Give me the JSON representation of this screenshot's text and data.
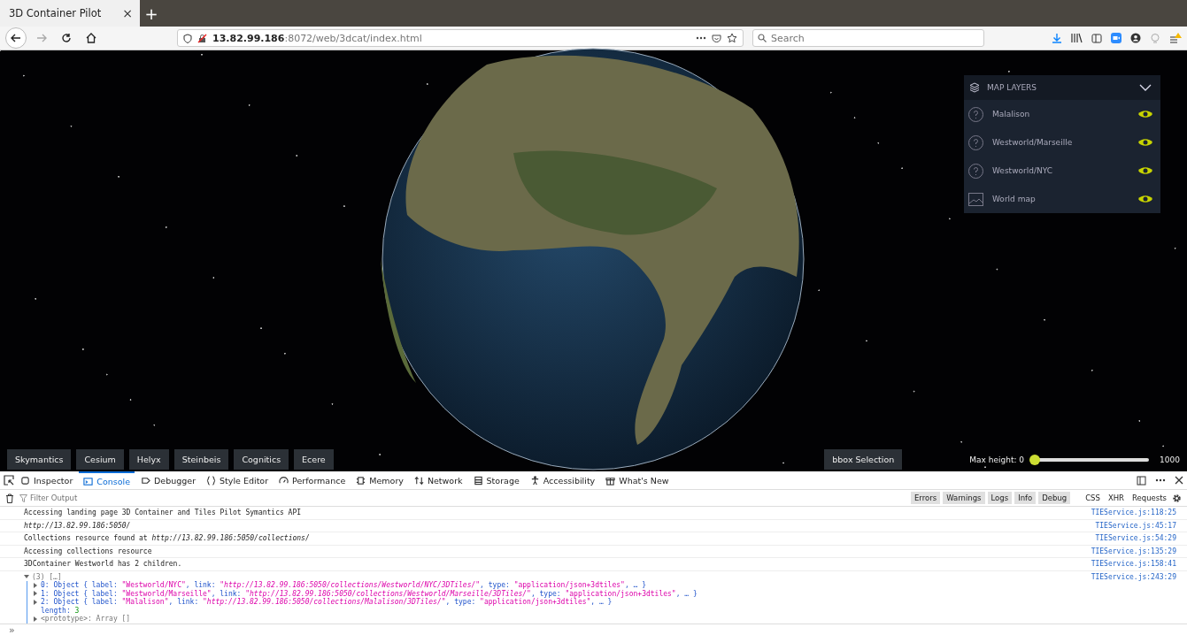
{
  "browser": {
    "tabs": [
      {
        "title": "3D Container Pilot",
        "close": "×",
        "selected": true
      }
    ],
    "new_tab": "+",
    "url": {
      "host": "13.82.99.186",
      "path": ":8072/web/3dcat/index.html"
    },
    "search": {
      "placeholder": "Search"
    }
  },
  "map_layers": {
    "title": "MAP LAYERS",
    "expanded": true,
    "layers": [
      {
        "name": "Malalison",
        "kind": "unknown",
        "visible": true
      },
      {
        "name": "Westworld/Marseille",
        "kind": "unknown",
        "visible": true
      },
      {
        "name": "Westworld/NYC",
        "kind": "unknown",
        "visible": true
      },
      {
        "name": "World map",
        "kind": "image",
        "visible": true
      }
    ]
  },
  "providers": [
    "Skymantics",
    "Cesium",
    "Helyx",
    "Steinbeis",
    "Cognitics",
    "Ecere"
  ],
  "bbox_button": "bbox Selection",
  "max_height": {
    "label": "Max height: 0",
    "level": 0,
    "max": "1000"
  },
  "devtools": {
    "tabs": [
      {
        "label": "Inspector",
        "selected": false
      },
      {
        "label": "Console",
        "selected": true
      },
      {
        "label": "Debugger",
        "selected": false
      },
      {
        "label": "Style Editor",
        "selected": false
      },
      {
        "label": "Performance",
        "selected": false
      },
      {
        "label": "Memory",
        "selected": false
      },
      {
        "label": "Network",
        "selected": false
      },
      {
        "label": "Storage",
        "selected": false
      },
      {
        "label": "Accessibility",
        "selected": false
      },
      {
        "label": "What's New",
        "selected": false
      }
    ],
    "filter_placeholder": "Filter Output",
    "levels": [
      "Errors",
      "Warnings",
      "Logs",
      "Info",
      "Debug"
    ],
    "extra_filters": [
      "CSS",
      "XHR",
      "Requests"
    ],
    "messages": [
      {
        "kind": "text",
        "text": "Accessing landing page 3D Container and Tiles Pilot Symantics API",
        "source": "TIEService.js:118:25"
      },
      {
        "kind": "italic",
        "text": "http://13.82.99.186:5050/",
        "source": "TIEService.js:45:17"
      },
      {
        "kind": "text",
        "text": "Collections resource found at *http://13.82.99.186:5050/collections/*",
        "source": "TIEService.js:54:29"
      },
      {
        "kind": "text",
        "text": "Accessing collections resource",
        "source": "TIEService.js:135:29"
      },
      {
        "kind": "text",
        "text": "3DContainer Westworld has 2 children.",
        "source": "TIEService.js:158:41"
      },
      {
        "kind": "array",
        "text": "(3) […]",
        "expanded": true,
        "source": "TIEService.js:243:29",
        "lines": [
          {
            "expandable": true,
            "segments": [
              {
                "kind": "code",
                "text": "0: Object { label: "
              },
              {
                "kind": "str",
                "text": "\"Westworld/NYC\""
              },
              {
                "kind": "code",
                "text": ", link: "
              },
              {
                "kind": "link",
                "text": "\"http://13.82.99.186:5050/collections/Westworld/NYC/3DTiles/\""
              },
              {
                "kind": "code",
                "text": ", type: "
              },
              {
                "kind": "str",
                "text": "\"application/json+3dtiles\""
              },
              {
                "kind": "code",
                "text": ", … }"
              }
            ]
          },
          {
            "expandable": true,
            "segments": [
              {
                "kind": "code",
                "text": "1: Object { label: "
              },
              {
                "kind": "str",
                "text": "\"Westworld/Marseille\""
              },
              {
                "kind": "code",
                "text": ", link: "
              },
              {
                "kind": "link",
                "text": "\"http://13.82.99.186:5050/collections/Westworld/Marseille/3DTiles/\""
              },
              {
                "kind": "code",
                "text": ", type: "
              },
              {
                "kind": "str",
                "text": "\"application/json+3dtiles\""
              },
              {
                "kind": "code",
                "text": ", … }"
              }
            ]
          },
          {
            "expandable": true,
            "segments": [
              {
                "kind": "code",
                "text": "2: Object { label: "
              },
              {
                "kind": "str",
                "text": "\"Malalison\""
              },
              {
                "kind": "code",
                "text": ", link: "
              },
              {
                "kind": "link",
                "text": "\"http://13.82.99.186:5050/collections/Malalison/3DTiles/\""
              },
              {
                "kind": "code",
                "text": ", type: "
              },
              {
                "kind": "str",
                "text": "\"application/json+3dtiles\""
              },
              {
                "kind": "code",
                "text": ", … }"
              }
            ]
          },
          {
            "expandable": false,
            "segments": [
              {
                "kind": "code",
                "text": "length: "
              },
              {
                "kind": "num",
                "text": "3"
              }
            ]
          },
          {
            "expandable": true,
            "segments": [
              {
                "kind": "grey",
                "text": "<prototype>: Array []"
              }
            ]
          }
        ]
      }
    ],
    "prompt": "»"
  }
}
